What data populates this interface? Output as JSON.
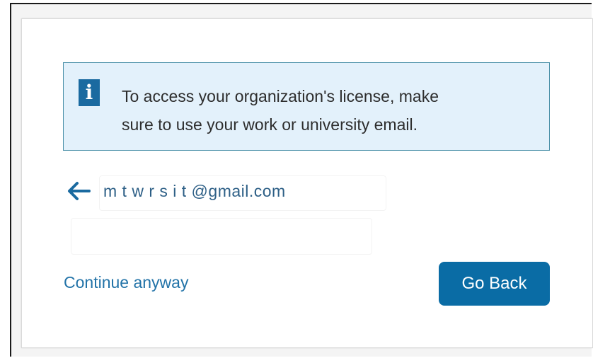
{
  "info": {
    "icon": "info-icon",
    "icon_glyph": "i",
    "line1": "To access your organization's license, make",
    "line2": "sure to use your work or university email."
  },
  "account": {
    "back_icon": "arrow-left-icon",
    "email": "m t w r s i t @gmail.com"
  },
  "actions": {
    "continue_label": "Continue anyway",
    "go_back_label": "Go Back"
  },
  "colors": {
    "accent": "#0a6ca5",
    "link": "#2273a8",
    "info_bg": "#e3f1fb",
    "info_border": "#4a90a8"
  }
}
